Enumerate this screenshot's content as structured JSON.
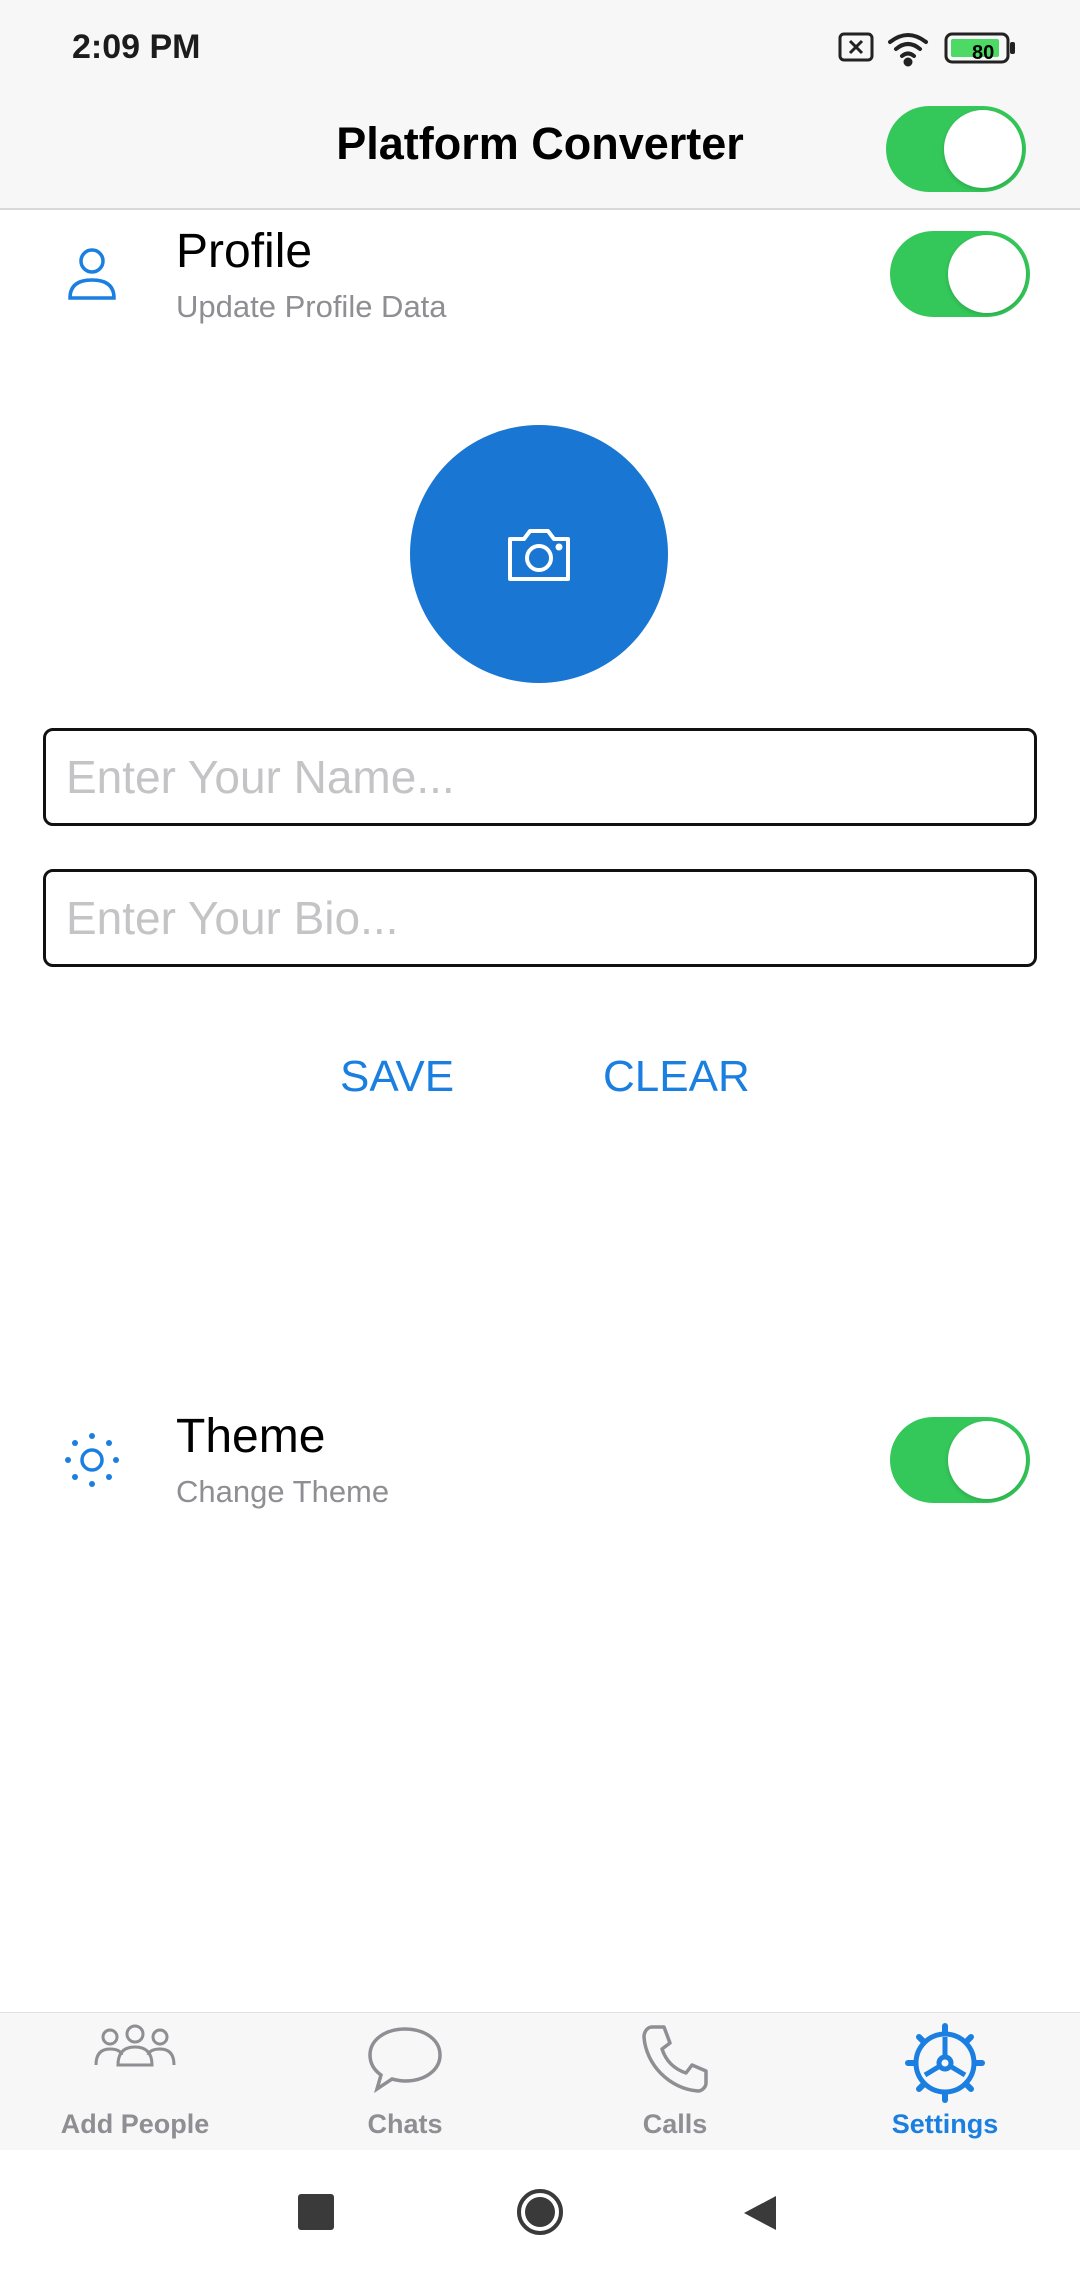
{
  "status_bar": {
    "time": "2:09 PM",
    "battery": "80"
  },
  "app_bar": {
    "title": "Platform Converter",
    "platform_toggle": true
  },
  "profile_row": {
    "title": "Profile",
    "subtitle": "Update Profile Data",
    "toggle": true
  },
  "form": {
    "name_placeholder": "Enter Your Name...",
    "bio_placeholder": "Enter Your Bio...",
    "save_label": "SAVE",
    "clear_label": "CLEAR"
  },
  "theme_row": {
    "title": "Theme",
    "subtitle": "Change Theme",
    "toggle": true
  },
  "tabs": [
    {
      "label": "Add People",
      "icon": "people-icon"
    },
    {
      "label": "Chats",
      "icon": "chat-bubble-icon"
    },
    {
      "label": "Calls",
      "icon": "phone-icon"
    },
    {
      "label": "Settings",
      "icon": "gear-icon",
      "active": true
    }
  ],
  "colors": {
    "accent": "#1a7fe0",
    "avatar": "#1976d2",
    "switch_on": "#34c759",
    "inactive": "#8e8e93"
  }
}
